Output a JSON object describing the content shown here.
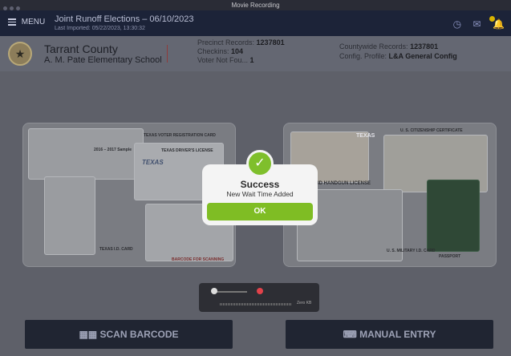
{
  "window": {
    "title": "Movie Recording"
  },
  "appbar": {
    "menu_label": "MENU",
    "election_title": "Joint Runoff Elections – 06/10/2023",
    "last_imported": "Last Imported: 05/22/2023, 13:30:32"
  },
  "info": {
    "county": "Tarrant County",
    "school": "A. M. Pate Elementary School",
    "precinct_label": "Precinct Records:",
    "precinct_value": "1237801",
    "checkins_label": "Checkins:",
    "checkins_value": "104",
    "notfound_label": "Voter Not Fou...",
    "notfound_value": "1",
    "countywide_label": "Countywide Records:",
    "countywide_value": "1237801",
    "config_label": "Config. Profile:",
    "config_value": "L&A General Config"
  },
  "left_card": {
    "captions": [
      "TEXAS VOTER REGISTRATION CARD",
      "TEXAS DRIVER'S LICENSE",
      "TEXAS I.D. CARD",
      "BARCODE FOR SCANNING",
      "TEXAS",
      "2016 – 2017 Sample"
    ]
  },
  "right_card": {
    "captions": [
      "U. S. CITIZENSHIP CERTIFICATE",
      "TEXAS",
      "ID HANDGUN LICENSE",
      "U. S. MILITARY I.D. CARD",
      "PASSPORT"
    ]
  },
  "buttons": {
    "scan": "SCAN BARCODE",
    "manual": "MANUAL ENTRY"
  },
  "recorder": {
    "size": "Zero KB"
  },
  "modal": {
    "title": "Success",
    "message": "New Wait Time Added",
    "ok": "OK"
  },
  "colors": {
    "accent": "#7fbd24",
    "appbar": "#1c2338"
  },
  "icons": [
    "menu-icon",
    "clock-icon",
    "mail-icon",
    "bell-icon",
    "check-icon",
    "barcode-icon",
    "keyboard-icon"
  ]
}
